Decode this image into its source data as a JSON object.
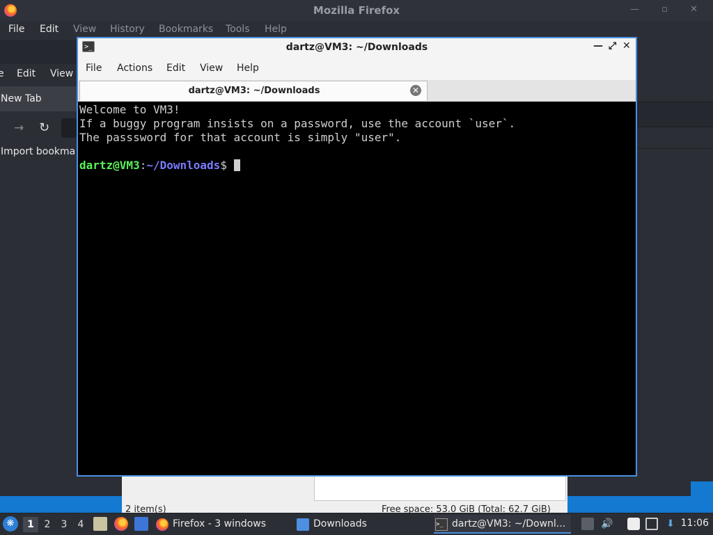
{
  "firefox": {
    "title": "Mozilla Firefox",
    "menu": [
      "File",
      "Edit",
      "View",
      "History",
      "Bookmarks",
      "Tools",
      "Help"
    ],
    "second_menu": [
      "e",
      "Edit",
      "View"
    ],
    "tab_label": "New Tab",
    "bookmark_item": "Import bookma"
  },
  "file_manager": {
    "status_items": "2 item(s)",
    "status_space": "Free space: 53.0 GiB (Total: 62.7 GiB)"
  },
  "terminal": {
    "title": "dartz@VM3: ~/Downloads",
    "menu": [
      "File",
      "Actions",
      "Edit",
      "View",
      "Help"
    ],
    "tab_label": "dartz@VM3: ~/Downloads",
    "lines": [
      "Welcome to VM3!",
      "If a buggy program insists on a password, use the account `user`.",
      "The passsword for that account is simply \"user\"."
    ],
    "prompt_user": "dartz@VM3",
    "prompt_sep": ":",
    "prompt_path": "~/Downloads",
    "prompt_symbol": "$ "
  },
  "taskbar": {
    "workspaces": [
      "1",
      "2",
      "3",
      "4"
    ],
    "items": [
      {
        "label": "Firefox - 3 windows",
        "icon": "firefox-icon"
      },
      {
        "label": "Downloads",
        "icon": "folder-icon"
      },
      {
        "label": "dartz@VM3: ~/Downl...",
        "icon": "terminal-icon"
      }
    ],
    "clock": "11:06"
  },
  "colors": {
    "accent": "#4a90e2",
    "prompt_user": "#5af05a",
    "prompt_path": "#7b7bff"
  }
}
